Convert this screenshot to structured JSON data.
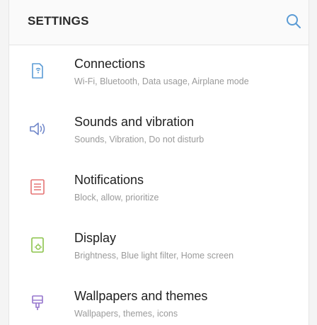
{
  "header": {
    "title": "SETTINGS",
    "search_icon": "search-icon"
  },
  "colors": {
    "accent": "#5a9bd5",
    "connections": "#5a9bd5",
    "sounds": "#6f86c9",
    "notifications": "#e57373",
    "display": "#8bc34a",
    "wallpapers": "#9575cd"
  },
  "items": [
    {
      "title": "Connections",
      "subtitle": "Wi-Fi, Bluetooth, Data usage, Airplane mode",
      "icon": "connections-icon"
    },
    {
      "title": "Sounds and vibration",
      "subtitle": "Sounds, Vibration, Do not disturb",
      "icon": "speaker-icon"
    },
    {
      "title": "Notifications",
      "subtitle": "Block, allow, prioritize",
      "icon": "notifications-icon"
    },
    {
      "title": "Display",
      "subtitle": "Brightness, Blue light filter, Home screen",
      "icon": "display-icon"
    },
    {
      "title": "Wallpapers and themes",
      "subtitle": "Wallpapers, themes, icons",
      "icon": "paintbrush-icon"
    }
  ]
}
